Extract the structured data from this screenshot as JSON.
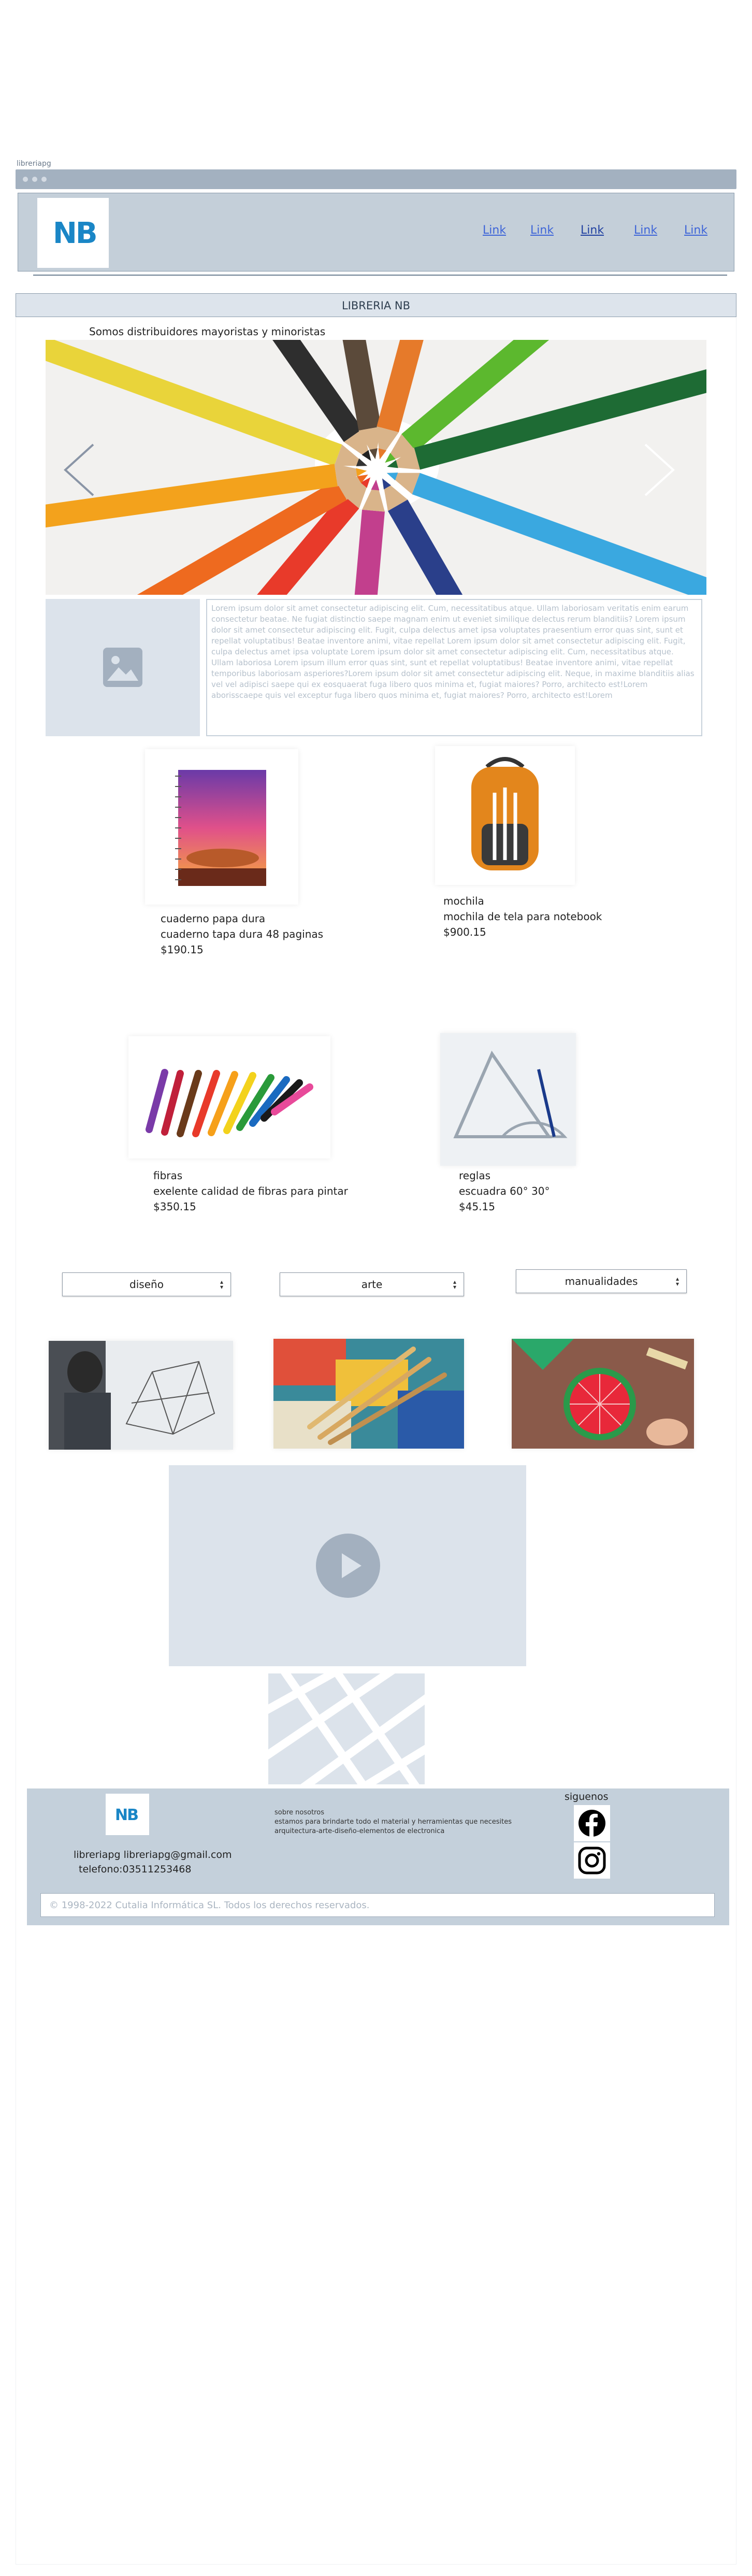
{
  "browser": {
    "tab_label": "libreriapg"
  },
  "navbar": {
    "logo_text": "NB",
    "links": [
      "Link",
      "Link",
      "Link",
      "Link",
      "Link"
    ]
  },
  "title_bar": {
    "title": "LIBRERIA NB"
  },
  "hero": {
    "tagline": "Somos distribuidores mayoristas y minoristas",
    "carousel_image": "colored-pencils-circle-photo",
    "prev_icon": "chevron-left-icon",
    "next_icon": "chevron-right-icon"
  },
  "intro": {
    "image_placeholder_icon": "image-icon",
    "lorem": "Lorem ipsum dolor sit amet consectetur adipiscing elit. Cum, necessitatibus atque. Ullam laboriosam veritatis enim earum consectetur beatae. Ne fugiat distinctio saepe magnam enim ut eveniet similique delectus rerum blanditiis? Lorem ipsum dolor sit amet consectetur adipiscing elit. Fugit, culpa delectus amet ipsa voluptates praesentium error quas sint, sunt et repellat voluptatibus! Beatae inventore animi, vitae repellat Lorem ipsum dolor sit amet consectetur adipiscing elit. Fugit, culpa delectus amet ipsa voluptate Lorem ipsum dolor sit amet consectetur adipiscing elit. Cum, necessitatibus atque. Ullam laboriosa Lorem ipsum illum error quas sint, sunt et repellat voluptatibus! Beatae inventore animi, vitae repellat temporibus laboriosam asperiores?Lorem ipsum dolor sit amet consectetur adipiscing elit. Neque, in maxime blanditiis alias vel vel adipisci saepe qui ex eosquaerat fuga libero quos minima et, fugiat maiores? Porro, architecto est!Lorem aborisscaepe quis vel exceptur fuga libero quos minima et, fugiat maiores? Porro, architecto est!Lorem"
  },
  "products": [
    {
      "name": "cuaderno papa dura",
      "description": "cuaderno tapa dura 48 paginas",
      "price": "$190.15"
    },
    {
      "name": "mochila",
      "description": "mochila de tela para notebook",
      "price": "$900.15"
    },
    {
      "name": "fibras",
      "description": "exelente calidad de fibras para pintar",
      "price": "$350.15"
    },
    {
      "name": "reglas",
      "description": "escuadra 60° 30°",
      "price": "$45.15"
    }
  ],
  "categories": [
    {
      "selected": "diseño",
      "image": "architecture-drawing-photo"
    },
    {
      "selected": "arte",
      "image": "paint-brushes-photo"
    },
    {
      "selected": "manualidades",
      "image": "paper-crafts-photo"
    }
  ],
  "media": {
    "video_icon": "play-icon",
    "map_icon": "map-icon"
  },
  "footer": {
    "logo_text": "NB",
    "email_line": "libreriapg  libreriapg@gmail.com",
    "phone_line": "telefono:03511253468",
    "about_title": "sobre nosotros",
    "about_line1": "estamos para brindarte todo el material y herramientas que necesites",
    "about_line2": "arquitectura-arte-diseño-elementos de electronica",
    "follow_label": "siguenos",
    "social": [
      "facebook-icon",
      "instagram-icon"
    ],
    "copyright": "© 1998-2022 Cutalia Informática SL. Todos los derechos reservados."
  },
  "colors": {
    "browser_bar": "#a3b1c0",
    "navbar_bg": "#c4cfd9",
    "link": "#3d64d8",
    "logo_blue": "#1a86c6",
    "placeholder": "#dce3eb",
    "footer_bg": "#c4d0db"
  }
}
